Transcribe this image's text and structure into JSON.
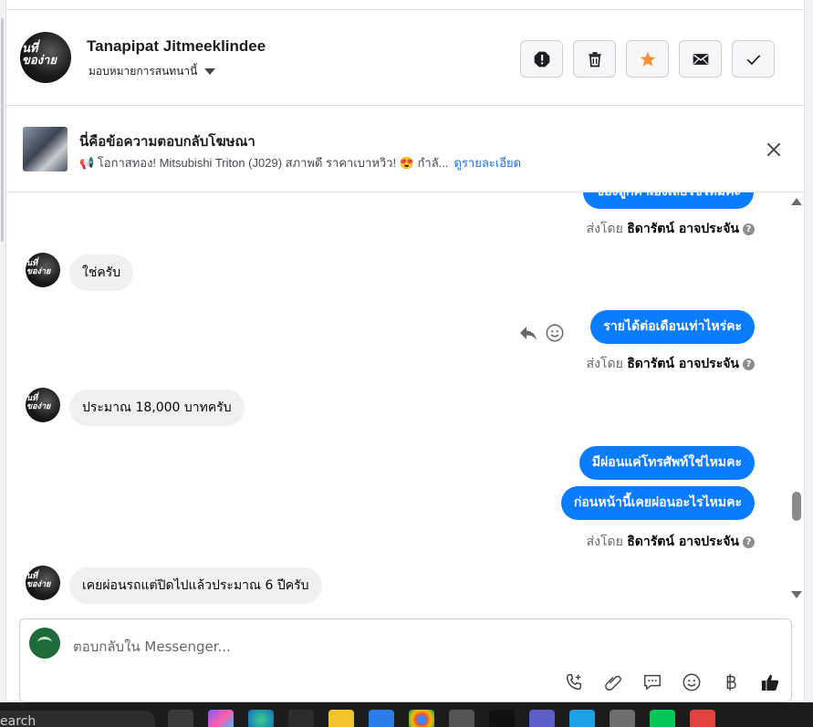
{
  "header": {
    "name": "Tanapipat Jitmeeklindee",
    "assign_label": "มอบหมายการสนทนานี้",
    "avatar_text": "นที่\nของ่าย"
  },
  "actions": [
    {
      "name": "spam",
      "icon": "alert-octagon-icon"
    },
    {
      "name": "delete",
      "icon": "trash-icon"
    },
    {
      "name": "star",
      "icon": "star-icon",
      "color": "#f7923a"
    },
    {
      "name": "mark-unread",
      "icon": "envelope-icon"
    },
    {
      "name": "done",
      "icon": "check-icon"
    }
  ],
  "ad": {
    "title": "นี่คือข้อความตอบกลับโฆษณา",
    "subtitle": "📢 โอกาสทอง! Mitsubishi Triton (J029) สภาพดี ราคาเบาหวิว! 😍 กำลั...",
    "link": "ดูรายละเอียด"
  },
  "messages": {
    "m0_out": "ของลูกค้าเองเลยใช่ไหมคะ",
    "m0_sent_prefix": "ส่งโดย",
    "m0_sent_name": "ธิดารัตน์ อาจประจัน",
    "m1_in": "ใช่ครับ",
    "m2_out": "รายได้ต่อเดือนเท่าไหร่คะ",
    "m2_sent_prefix": "ส่งโดย",
    "m2_sent_name": "ธิดารัตน์ อาจประจัน",
    "m3_in": "ประมาณ 18,000 บาทครับ",
    "m4_out": "มีผ่อนแค่โทรศัพท์ใช่ไหมคะ",
    "m5_out": "ก่อนหน้านี้เคยผ่อนอะไรไหมคะ",
    "m5_sent_prefix": "ส่งโดย",
    "m5_sent_name": "ธิดารัตน์ อาจประจัน",
    "m6_in": "เคยผ่อนรถแต่ปิดไปแล้วประมาณ 6 ปีครับ"
  },
  "composer": {
    "placeholder": "ตอบกลับใน Messenger..."
  },
  "composer_tools": [
    "phone-plus-icon",
    "paperclip-icon",
    "chat-bubble-icon",
    "emoji-icon",
    "baht-icon",
    "thumbs-up-icon"
  ],
  "taskbar": {
    "search_text": "earch"
  },
  "colors": {
    "accent": "#0a7cff",
    "link": "#1b74e4",
    "star": "#f7923a"
  }
}
